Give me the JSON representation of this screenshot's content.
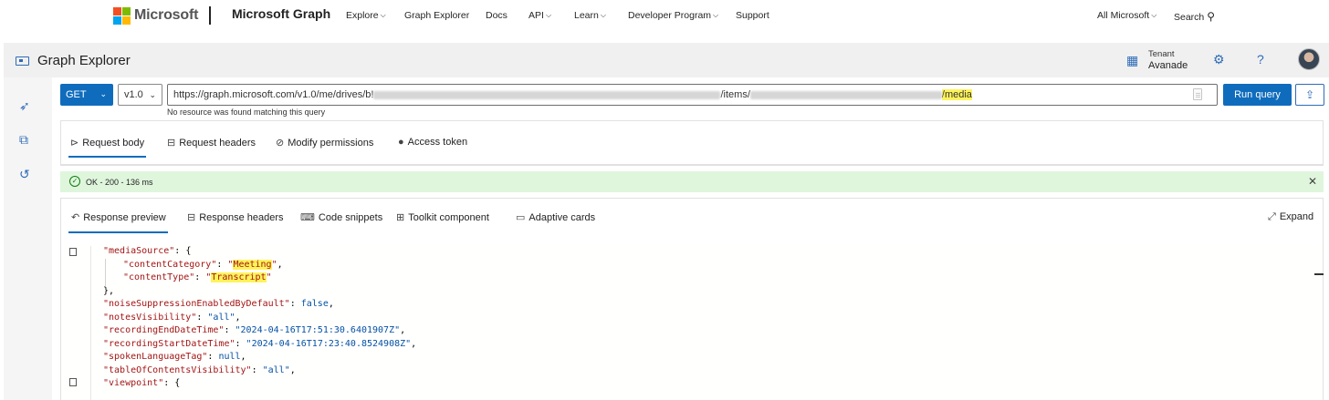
{
  "topnav": {
    "brand": "Microsoft",
    "product": "Microsoft Graph",
    "links": [
      "Explore",
      "Graph Explorer",
      "Docs",
      "API",
      "Learn",
      "Developer Program",
      "Support"
    ],
    "all_microsoft": "All Microsoft",
    "search": "Search",
    "logo_colors": [
      "#f25022",
      "#7fba00",
      "#00a4ef",
      "#ffb900"
    ]
  },
  "header": {
    "title": "Graph Explorer",
    "tenant_label": "Tenant",
    "tenant_value": "Avanade"
  },
  "query": {
    "method": "GET",
    "version": "v1.0",
    "url_prefix": "https://graph.microsoft.com/v1.0/me/drives/b!",
    "url_mid": "/items/",
    "url_end": "/media",
    "run_label": "Run query",
    "hint": "No resource was found matching this query"
  },
  "request_tabs": [
    "Request body",
    "Request headers",
    "Modify permissions",
    "Access token"
  ],
  "status": {
    "text": "OK - 200 - 136 ms",
    "color": "#dff6dd"
  },
  "response_tabs": [
    "Response preview",
    "Response headers",
    "Code snippets",
    "Toolkit component",
    "Adaptive cards"
  ],
  "expand_label": "Expand",
  "code": {
    "l1_key": "\"mediaSource\"",
    "l1_rest": ": {",
    "l2_key": "\"contentCategory\"",
    "l2_val": "Meeting",
    "l3_key": "\"contentType\"",
    "l3_val": "Transcript",
    "l4": "},",
    "l5_key": "\"noiseSuppressionEnabledByDefault\"",
    "l5_val": "false",
    "l6_key": "\"notesVisibility\"",
    "l6_val": "\"all\"",
    "l7_key": "\"recordingEndDateTime\"",
    "l7_val": "\"2024-04-16T17:51:30.6401907Z\"",
    "l8_key": "\"recordingStartDateTime\"",
    "l8_val": "\"2024-04-16T17:23:40.8524908Z\"",
    "l9_key": "\"spokenLanguageTag\"",
    "l9_val": "null",
    "l10_key": "\"tableOfContentsVisibility\"",
    "l10_val": "\"all\"",
    "l11_key": "\"viewpoint\"",
    "l11_rest": ": {"
  }
}
